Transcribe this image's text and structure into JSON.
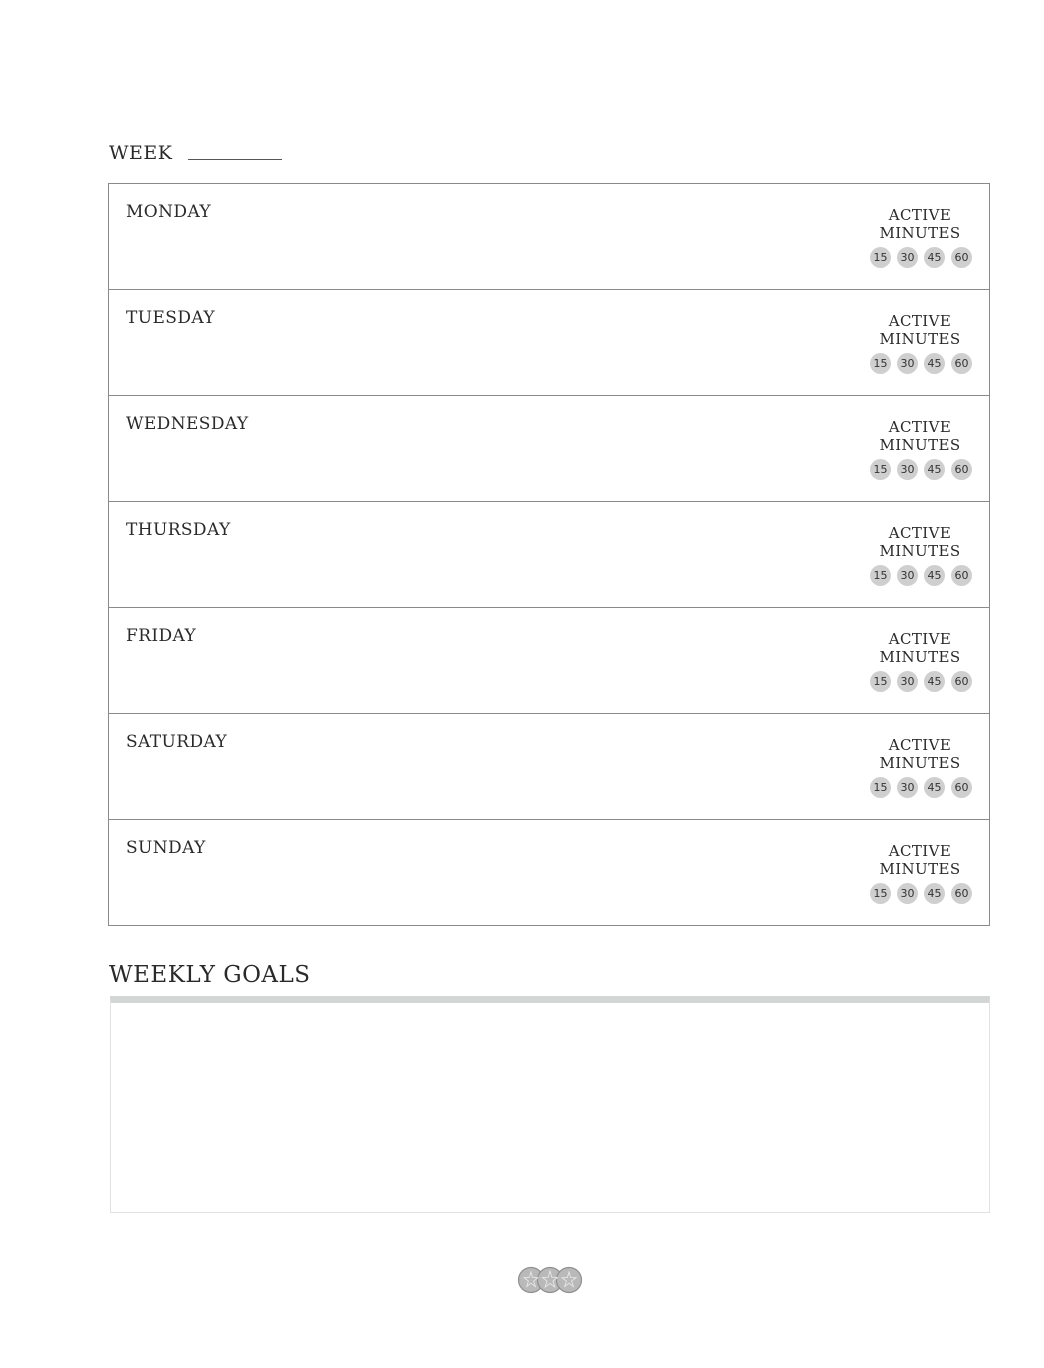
{
  "header": {
    "week_label": "WEEK"
  },
  "active_block": {
    "line1": "ACTIVE",
    "line2": "MINUTES",
    "minutes": [
      "15",
      "30",
      "45",
      "60"
    ]
  },
  "days": [
    {
      "name": "MONDAY"
    },
    {
      "name": "TUESDAY"
    },
    {
      "name": "WEDNESDAY"
    },
    {
      "name": "THURSDAY"
    },
    {
      "name": "FRIDAY"
    },
    {
      "name": "SATURDAY"
    },
    {
      "name": "SUNDAY"
    }
  ],
  "goals": {
    "title": "WEEKLY GOALS"
  },
  "footer": {
    "logo_icon": "three-star-circles-icon"
  },
  "colors": {
    "border": "#8a8a8a",
    "circle_fill": "#cfcfcf",
    "goals_bar": "#d4d6d6",
    "text": "#2a2a2a"
  }
}
